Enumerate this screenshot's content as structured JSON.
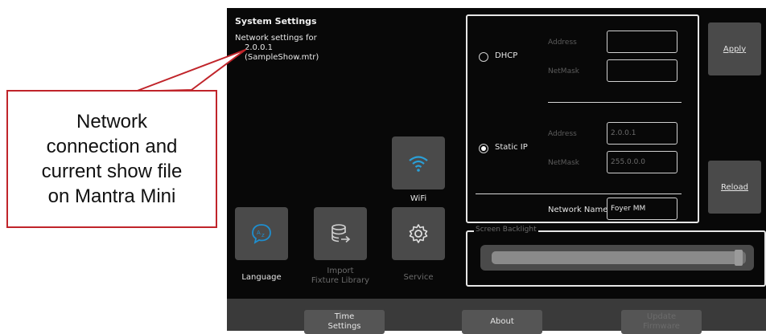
{
  "header": {
    "title": "System Settings",
    "network_label": "Network settings for",
    "ip": "2.0.0.1",
    "show_file": "(SampleShow.mtr)"
  },
  "tiles": {
    "wifi": "WiFi",
    "language": "Language",
    "import": "Import\nFixture Library",
    "service": "Service"
  },
  "network": {
    "dhcp_label": "DHCP",
    "dhcp_address_label": "Address",
    "dhcp_netmask_label": "NetMask",
    "dhcp_address_value": "",
    "dhcp_netmask_value": "",
    "static_label": "Static IP",
    "static_address_label": "Address",
    "static_netmask_label": "NetMask",
    "static_address_value": "2.0.0.1",
    "static_netmask_value": "255.0.0.0",
    "name_label": "Network Name",
    "name_value": "Foyer MM",
    "selected": "Static IP"
  },
  "side_buttons": {
    "apply": "Apply",
    "reload": "Reload"
  },
  "backlight": {
    "label": "Screen Backlight",
    "level": 0.98
  },
  "bottom": {
    "time": "Time\nSettings",
    "about": "About",
    "update": "Update\nFirmware"
  },
  "callout": {
    "text": "Network\nconnection and\ncurrent show file\non Mantra Mini"
  },
  "colors": {
    "wifi_accent": "#2aa0d8",
    "language_accent": "#1e8fd0",
    "callout_border": "#c0242a"
  }
}
